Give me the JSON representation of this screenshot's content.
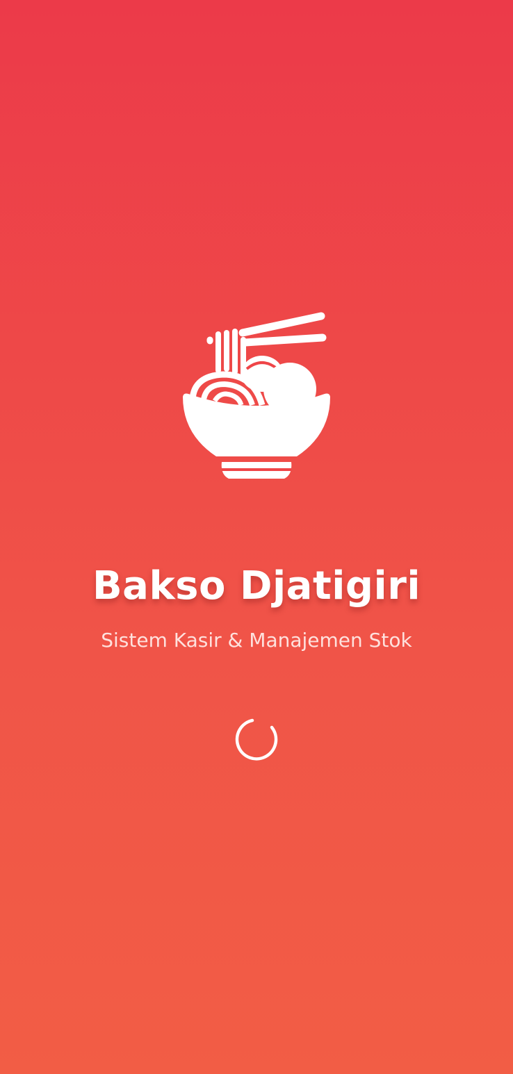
{
  "app": {
    "title": "Bakso Djatigiri",
    "subtitle": "Sistem Kasir & Manajemen Stok"
  },
  "logo": {
    "icon": "noodle-bowl-icon"
  },
  "loading": {
    "icon": "loading-spinner-icon"
  },
  "colors": {
    "gradient_top": "#ec3a49",
    "gradient_bottom": "#f25d45",
    "foreground": "#ffffff"
  }
}
